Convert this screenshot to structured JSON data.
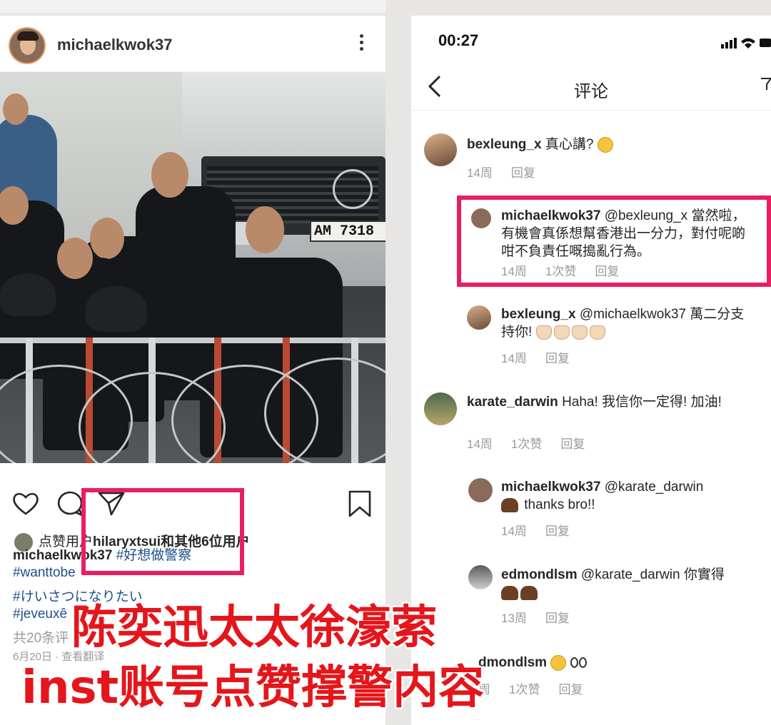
{
  "post": {
    "username": "michaelkwok37",
    "liked_by_prefix": "点赞用户",
    "liked_by_user": "hilaryxtsui",
    "liked_by_suffix": "和其他6",
    "liked_by_tail": "位用户",
    "caption_user": "michaelkwok37",
    "caption_tag": "#好想做警察",
    "tag2": "#wanttobe",
    "tag3": "#けいさつになりたい",
    "tag4": "#jeveuxê",
    "comments_count": "共20条评",
    "date_translate": "6月20日 · 查看翻译",
    "plate": "AM 7318"
  },
  "overlay": {
    "line1": "陈奕迅太太徐濠萦",
    "line2": "inst账号点赞撑警内容"
  },
  "status": {
    "time": "00:27"
  },
  "comments_screen": {
    "title": "评论",
    "comments": [
      {
        "user": "bexleung_x",
        "text": "真心講?",
        "age": "14周",
        "reply": "回复"
      },
      {
        "user": "michaelkwok37",
        "mention": "@bexleung_x",
        "text": "當然啦，有機會真係想幫香港出一分力，對付呢啲咁不負責任嘅搗亂行為。",
        "age": "14周",
        "likes": "1次赞",
        "reply": "回复"
      },
      {
        "user": "bexleung_x",
        "mention": "@michaelkwok37",
        "text": "萬二分支持你!",
        "age": "14周",
        "reply": "回复"
      },
      {
        "user": "karate_darwin",
        "text": "Haha! 我信你一定得! 加油!",
        "age": "14周",
        "likes": "1次赞",
        "reply": "回复"
      },
      {
        "user": "michaelkwok37",
        "mention": "@karate_darwin",
        "text": "thanks bro!!",
        "age": "14周",
        "reply": "回复"
      },
      {
        "user": "edmondlsm",
        "mention": "@karate_darwin",
        "text": "你實得",
        "age": "13周",
        "reply": "回复"
      },
      {
        "user": "dmondlsm",
        "age": "周",
        "likes": "1次赞",
        "reply": "回复"
      }
    ]
  },
  "colors": {
    "highlight": "#e91e63",
    "overlay_red": "#e4161b",
    "link": "#1f4f8a"
  }
}
